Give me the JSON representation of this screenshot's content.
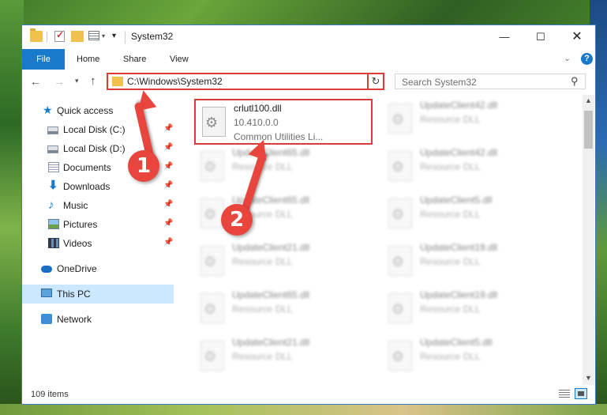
{
  "window": {
    "title": "System32",
    "controls": {
      "minimize": "—",
      "maximize": "☐",
      "close": "✕"
    }
  },
  "ribbon": {
    "tabs": [
      "File",
      "Home",
      "Share",
      "View"
    ],
    "help": "?"
  },
  "address_bar": {
    "path": "C:\\Windows\\System32",
    "search_placeholder": "Search System32"
  },
  "nav_pane": {
    "items": [
      {
        "label": "Quick access",
        "icon": "star-icon",
        "pinned": false
      },
      {
        "label": "Local Disk (C:)",
        "icon": "disk-icon",
        "pinned": true
      },
      {
        "label": "Local Disk (D:)",
        "icon": "disk-icon",
        "pinned": true
      },
      {
        "label": "Documents",
        "icon": "documents-icon",
        "pinned": true
      },
      {
        "label": "Downloads",
        "icon": "download-icon",
        "pinned": true
      },
      {
        "label": "Music",
        "icon": "music-icon",
        "pinned": true
      },
      {
        "label": "Pictures",
        "icon": "pictures-icon",
        "pinned": true
      },
      {
        "label": "Videos",
        "icon": "videos-icon",
        "pinned": true
      },
      {
        "label": "OneDrive",
        "icon": "cloud-icon",
        "pinned": false
      },
      {
        "label": "This PC",
        "icon": "computer-icon",
        "pinned": false,
        "selected": true
      },
      {
        "label": "Network",
        "icon": "network-icon",
        "pinned": false
      }
    ]
  },
  "files": [
    {
      "name": "crlutl100.dll",
      "version": "10.410.0.0",
      "description": "Common Utilities Li...",
      "highlighted": true
    },
    {
      "name": "UpdateClient42.dll",
      "type": "Resource DLL"
    },
    {
      "name": "UpdateClient65.dll",
      "type": "Resource DLL"
    },
    {
      "name": "UpdateClient42.dll",
      "type": "Resource DLL"
    },
    {
      "name": "UpdateClient65.dll",
      "type": "Resource DLL"
    },
    {
      "name": "UpdateClient5.dll",
      "type": "Resource DLL"
    },
    {
      "name": "UpdateClient21.dll",
      "type": "Resource DLL"
    },
    {
      "name": "UpdateClient19.dll",
      "type": "Resource DLL"
    },
    {
      "name": "UpdateClient65.dll",
      "type": "Resource DLL"
    },
    {
      "name": "UpdateClient19.dll",
      "type": "Resource DLL"
    },
    {
      "name": "UpdateClient21.dll",
      "type": "Resource DLL"
    },
    {
      "name": "UpdateClient5.dll",
      "type": "Resource DLL"
    }
  ],
  "status_bar": {
    "item_count": "109 items"
  },
  "annotations": {
    "badge1": "1",
    "badge2": "2"
  },
  "colors": {
    "accent": "#1979ca",
    "highlight": "#dc3b3b",
    "selected_bg": "#cce8ff"
  }
}
